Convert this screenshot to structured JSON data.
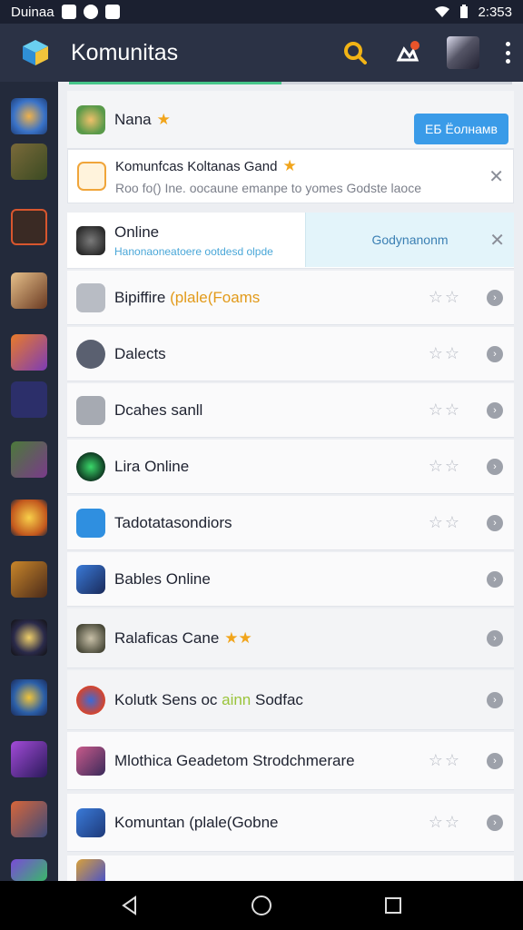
{
  "status_bar": {
    "left_text": "Duinaa",
    "time": "2:353"
  },
  "app_bar": {
    "title": "Komunitas"
  },
  "colors": {
    "accent": "#3a9be8",
    "highlight": "#e29a1a",
    "progress": "#46c68a"
  },
  "progress": 0.48,
  "top_row": {
    "name": "Nana",
    "star": "★",
    "button": "ЕБ Ёолнамв"
  },
  "featured": {
    "title": "Komunfcas Koltanas Gand",
    "star": "★",
    "subtitle": "Roo fo() Ine. oocaune emanpe to yomes Godste laoce"
  },
  "online_row": {
    "title": "Online",
    "subtitle": "Hanonaoneatoere ootdesd olpde",
    "button": "Godynanonm"
  },
  "rows": [
    {
      "title": "Bipiffire ",
      "title_highlight": "(plale(Foams",
      "stars": "☆☆"
    },
    {
      "title": "Dalects",
      "stars": "☆☆"
    },
    {
      "title": "Dcahes sanll",
      "stars": "☆☆"
    },
    {
      "title": "Lira Online",
      "stars": "☆☆"
    },
    {
      "title": "Tadotatasondiors",
      "stars": "☆☆"
    },
    {
      "title": "Bables Online",
      "stars": ""
    },
    {
      "title": "Ralaficas Cane",
      "title_star": "★★",
      "stars": ""
    },
    {
      "title": "Kolutk Sens oc ",
      "title_highlight": "ainn",
      "title_tail": " Sodfac",
      "stars": ""
    },
    {
      "title": "Mlothica Geadetom Strodchmerare",
      "stars": "☆☆"
    },
    {
      "title": "Komuntan (plale(Gobne",
      "highlight": true,
      "stars": "☆☆"
    }
  ],
  "icons": {
    "row_go": "chevron-go-icon",
    "close": "close-icon"
  }
}
